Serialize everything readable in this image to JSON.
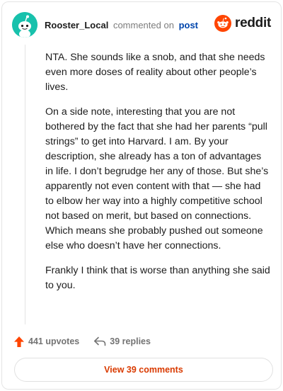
{
  "header": {
    "username": "Rooster_Local",
    "action_text": "commented on",
    "post_link": "post",
    "brand": "reddit"
  },
  "comment": {
    "paragraphs": [
      "NTA. She sounds like a snob, and that she needs even more doses of reality about other people’s lives.",
      "On a side note, interesting that you are not bothered by the fact that she had her parents “pull strings” to get into Harvard. I am. By your description, she already has a ton of advantages in life. I don’t begrudge her any of those. But she’s apparently not even content with that — she had to elbow her way into a highly competitive school not based on merit, but based on connections. Which means she probably pushed out someone else who doesn’t have her connections.",
      "Frankly I think that is worse than anything she said to you."
    ]
  },
  "footer": {
    "upvotes": "441 upvotes",
    "replies": "39 replies",
    "view_comments": "View 39 comments"
  },
  "colors": {
    "accent": "#ff4500",
    "avatar_bg": "#18c1ac",
    "link": "#0045ac",
    "view_button_text": "#d93a00"
  },
  "icons": [
    "snoo-avatar-icon",
    "reddit-logo-icon",
    "upvote-arrow-icon",
    "reply-arrow-icon"
  ]
}
